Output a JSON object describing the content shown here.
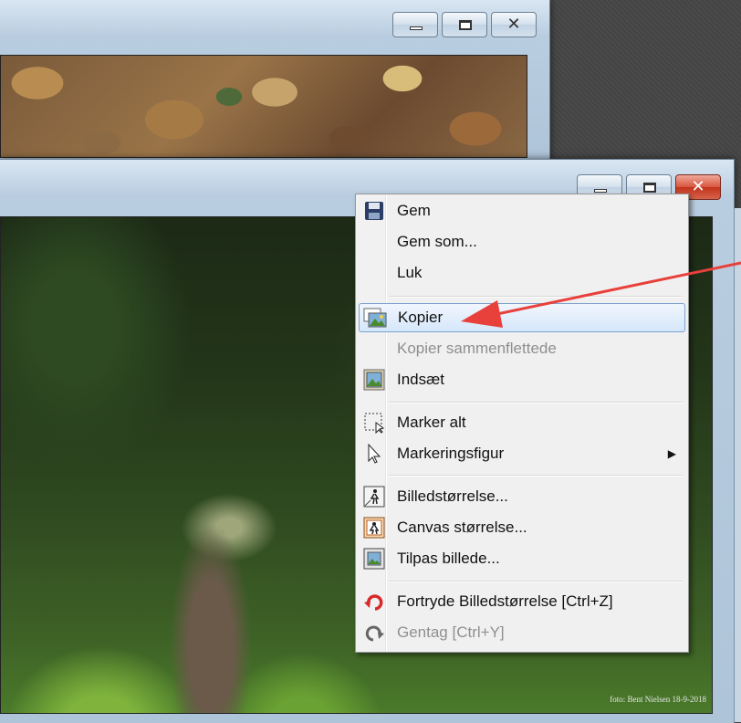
{
  "window_back": {
    "buttons": {
      "minimize": "minimize",
      "maximize": "maximize",
      "close": "close"
    }
  },
  "window_front": {
    "buttons": {
      "minimize": "minimize",
      "maximize": "maximize",
      "close": "close"
    },
    "photo_credit": "foto: Bent Nielsen 18-9-2018"
  },
  "context_menu": {
    "items": [
      {
        "label": "Gem",
        "icon": "save-icon",
        "enabled": true
      },
      {
        "label": "Gem som...",
        "icon": "",
        "enabled": true
      },
      {
        "label": "Luk",
        "icon": "",
        "enabled": true
      },
      {
        "label": "Kopier",
        "icon": "copy-image-icon",
        "enabled": true,
        "highlighted": true
      },
      {
        "label": "Kopier sammenflettede",
        "icon": "",
        "enabled": false
      },
      {
        "label": "Indsæt",
        "icon": "paste-image-icon",
        "enabled": true
      },
      {
        "label": "Marker alt",
        "icon": "select-all-icon",
        "enabled": true
      },
      {
        "label": "Markeringsfigur",
        "icon": "cursor-icon",
        "enabled": true,
        "submenu": true
      },
      {
        "label": "Billedstørrelse...",
        "icon": "image-size-icon",
        "enabled": true
      },
      {
        "label": "Canvas størrelse...",
        "icon": "canvas-size-icon",
        "enabled": true
      },
      {
        "label": "Tilpas billede...",
        "icon": "fit-image-icon",
        "enabled": true
      },
      {
        "label": "Fortryde Billedstørrelse [Ctrl+Z]",
        "icon": "undo-icon",
        "enabled": true
      },
      {
        "label": "Gentag [Ctrl+Y]",
        "icon": "redo-icon",
        "enabled": false
      }
    ]
  },
  "annotation": {
    "arrow_color": "#e8403b",
    "points_to": "Kopier"
  }
}
